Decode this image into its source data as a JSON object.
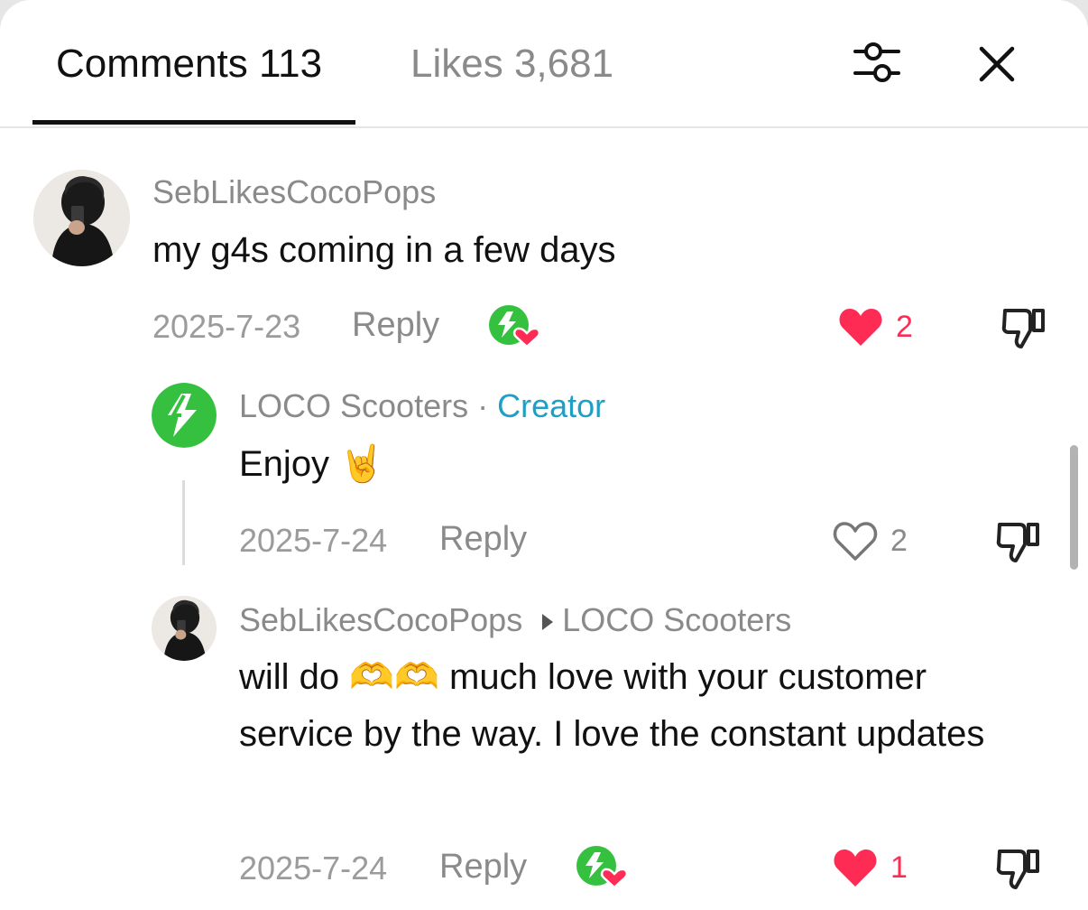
{
  "tabs": {
    "comments_label": "Comments 113",
    "likes_label": "Likes 3,681"
  },
  "colors": {
    "like_red": "#fe2c55",
    "creator_blue": "#1ea0c6",
    "loco_green": "#35c13f"
  },
  "comments": [
    {
      "username": "SebLikesCocoPops",
      "text": "my g4s coming in a few days",
      "date": "2025-7-23",
      "reply_label": "Reply",
      "likes": "2",
      "liked": true,
      "creator_liked": true
    }
  ],
  "replies": [
    {
      "username": "LOCO Scooters",
      "separator": "·",
      "badge": "Creator",
      "text": "Enjoy",
      "emoji": "🤘",
      "date": "2025-7-24",
      "reply_label": "Reply",
      "likes": "2",
      "liked": false
    },
    {
      "username": "SebLikesCocoPops",
      "reply_to": "LOCO Scooters",
      "text_start": "will do",
      "emoji": "🫶🫶",
      "text_end": "much love with your customer service by the way. I love the constant updates",
      "date": "2025-7-24",
      "reply_label": "Reply",
      "likes": "1",
      "liked": true,
      "creator_liked": true
    }
  ]
}
